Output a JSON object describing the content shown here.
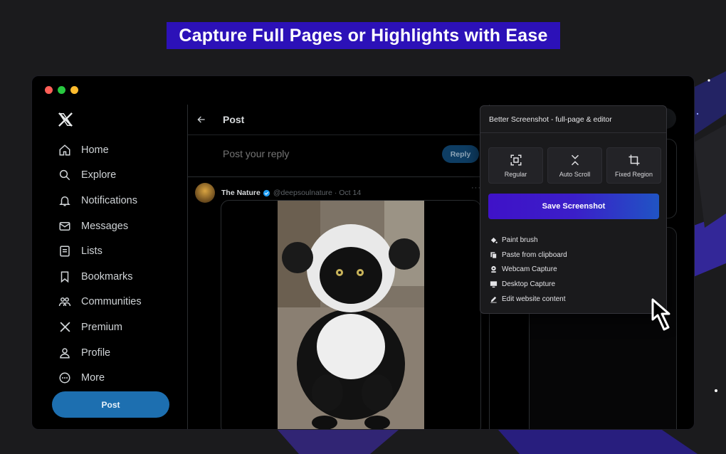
{
  "headline": "Capture Full Pages or Highlights with Ease",
  "colors": {
    "accent": "#2c11b8",
    "twitter_blue": "#1d6fb0",
    "save_gradient_start": "#3f12c8",
    "save_gradient_end": "#2054c4"
  },
  "sidebar": {
    "logo": "x-logo-icon",
    "items": [
      {
        "label": "Home",
        "icon": "home-icon"
      },
      {
        "label": "Explore",
        "icon": "search-icon"
      },
      {
        "label": "Notifications",
        "icon": "bell-icon"
      },
      {
        "label": "Messages",
        "icon": "mail-icon"
      },
      {
        "label": "Lists",
        "icon": "list-icon"
      },
      {
        "label": "Bookmarks",
        "icon": "bookmark-icon"
      },
      {
        "label": "Communities",
        "icon": "communities-icon"
      },
      {
        "label": "Premium",
        "icon": "x-icon"
      },
      {
        "label": "Profile",
        "icon": "person-icon"
      },
      {
        "label": "More",
        "icon": "more-circle-icon"
      }
    ],
    "post_button": "Post"
  },
  "main": {
    "title": "Post",
    "reply_placeholder": "Post your reply",
    "reply_button": "Reply",
    "tweet": {
      "name": "The Nature",
      "meta": "@deepsoulnature · Oct 14",
      "more": "···"
    }
  },
  "extension": {
    "title": "Better Screenshot - full-page & editor",
    "modes": [
      {
        "label": "Regular",
        "icon": "regular-capture-icon"
      },
      {
        "label": "Auto Scroll",
        "icon": "auto-scroll-icon"
      },
      {
        "label": "Fixed Region",
        "icon": "crop-icon"
      }
    ],
    "save_button": "Save Screenshot",
    "tools": [
      {
        "label": "Paint brush",
        "icon": "paint-bucket-icon"
      },
      {
        "label": "Paste from clipboard",
        "icon": "clipboard-icon"
      },
      {
        "label": "Webcam Capture",
        "icon": "webcam-icon"
      },
      {
        "label": "Desktop Capture",
        "icon": "desktop-icon"
      },
      {
        "label": "Edit website content",
        "icon": "pencil-icon"
      }
    ]
  }
}
